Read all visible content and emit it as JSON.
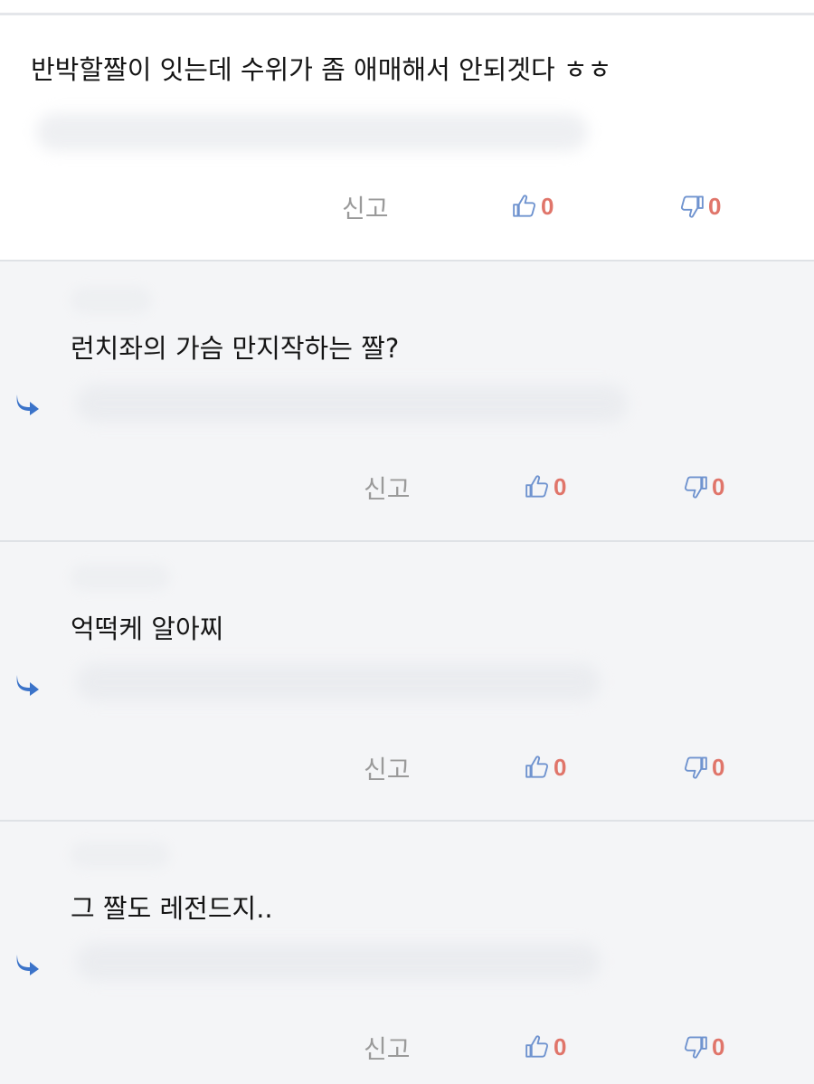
{
  "comments": [
    {
      "text": "반박할짤이 잇는데 수위가 좀 애매해서 안되겟다 ㅎㅎ",
      "report": "신고",
      "likes": "0",
      "dislikes": "0",
      "reply": false
    },
    {
      "text": "런치좌의 가슴 만지작하는 짤?",
      "report": "신고",
      "likes": "0",
      "dislikes": "0",
      "reply": true
    },
    {
      "text": "억떡케 알아찌",
      "report": "신고",
      "likes": "0",
      "dislikes": "0",
      "reply": true
    },
    {
      "text": "그 짤도 레전드지..",
      "report": "신고",
      "likes": "0",
      "dislikes": "0",
      "reply": true
    }
  ],
  "colors": {
    "thumb_icon": "#6f93cf",
    "count": "#e0756a",
    "reply_arrow": "#3b73c9",
    "reply_bg": "#f4f5f7"
  },
  "icons": {
    "reply": "reply-arrow-icon",
    "like": "thumbs-up-icon",
    "dislike": "thumbs-down-icon"
  }
}
